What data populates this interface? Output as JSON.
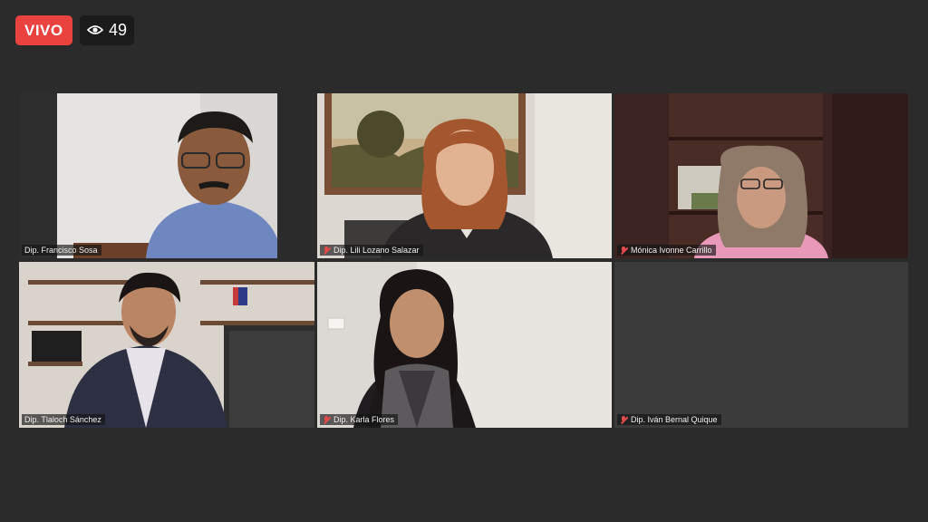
{
  "stream": {
    "live_label": "VIVO",
    "viewer_count": "49"
  },
  "participants": [
    {
      "name": "Dip. Francisco Sosa",
      "muted": false
    },
    {
      "name": "Dip. Lili Lozano Salazar",
      "muted": true
    },
    {
      "name": "Mónica Ivonne Carrillo",
      "muted": true
    },
    {
      "name": "Dip. Tlaloch Sánchez",
      "muted": false,
      "active_speaker": true
    },
    {
      "name": "Dip. Karla Flores",
      "muted": true
    },
    {
      "name": "Dip. Iván Bernal Quique",
      "muted": true
    }
  ],
  "colors": {
    "live_badge": "#e9423f",
    "active_speaker_border": "#b5d96a",
    "mic_muted": "#e04a4a"
  }
}
